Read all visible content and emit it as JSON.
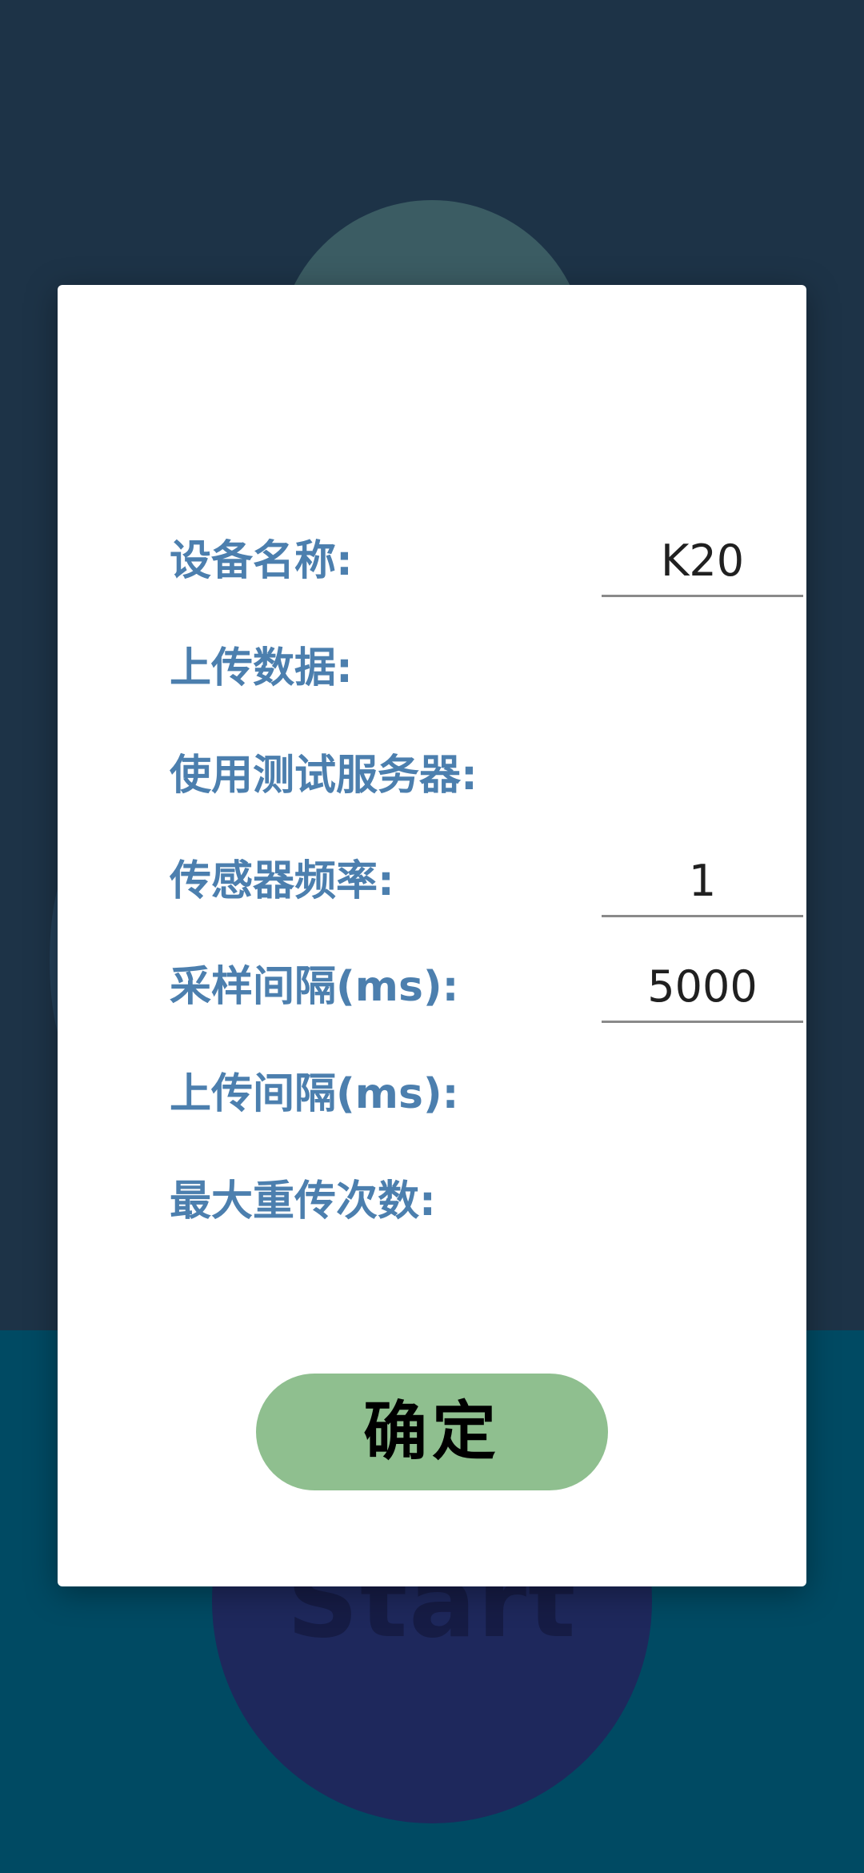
{
  "background": {
    "start_label": "Start"
  },
  "dialog": {
    "rows": [
      {
        "label": "设备名称:",
        "value": "K20"
      },
      {
        "label": "上传数据:"
      },
      {
        "label": "使用测试服务器:"
      },
      {
        "label": "传感器频率:",
        "value": "1"
      },
      {
        "label": "采样间隔(ms):",
        "value": "5000"
      },
      {
        "label": "上传间隔(ms):"
      },
      {
        "label": "最大重传次数:"
      }
    ],
    "confirm_label": "确定"
  },
  "colors": {
    "label": "#4c7fae",
    "confirm_button": "#8fbf8f",
    "background_top": "#1d3347",
    "background_bottom": "#004a63"
  }
}
